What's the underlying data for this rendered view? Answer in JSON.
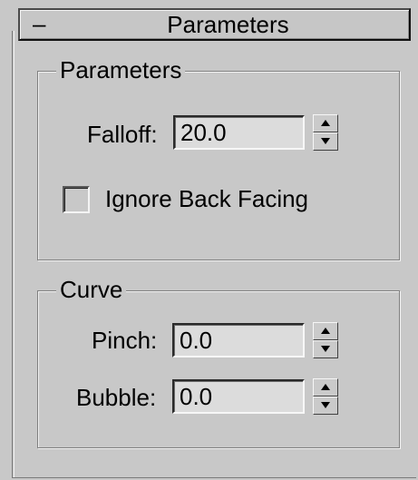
{
  "rollout": {
    "collapse_symbol": "–",
    "title": "Parameters"
  },
  "parameters_group": {
    "legend": "Parameters",
    "falloff_label": "Falloff:",
    "falloff_value": "20.0",
    "ignore_back_facing_label": "Ignore Back Facing",
    "ignore_back_facing_checked": false
  },
  "curve_group": {
    "legend": "Curve",
    "pinch_label": "Pinch:",
    "pinch_value": "0.0",
    "bubble_label": "Bubble:",
    "bubble_value": "0.0"
  }
}
